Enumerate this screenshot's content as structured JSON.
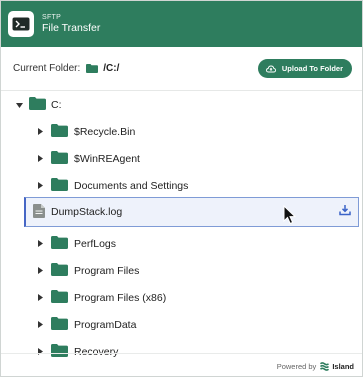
{
  "header": {
    "subtitle": "SFTP",
    "title": "File Transfer",
    "accent_color": "#2e7d5e"
  },
  "folder_bar": {
    "label": "Current Folder:",
    "path": "/C:/",
    "upload_button_label": "Upload To Folder"
  },
  "tree": {
    "root": {
      "name": "C:",
      "expanded": true
    },
    "items": [
      {
        "name": "$Recycle.Bin",
        "type": "folder"
      },
      {
        "name": "$WinREAgent",
        "type": "folder"
      },
      {
        "name": "Documents and Settings",
        "type": "folder"
      },
      {
        "name": "DumpStack.log",
        "type": "file",
        "selected": true
      },
      {
        "name": "PerfLogs",
        "type": "folder"
      },
      {
        "name": "Program Files",
        "type": "folder"
      },
      {
        "name": "Program Files (x86)",
        "type": "folder"
      },
      {
        "name": "ProgramData",
        "type": "folder"
      },
      {
        "name": "Recovery",
        "type": "folder"
      }
    ]
  },
  "footer": {
    "powered_by": "Powered by",
    "brand": "Island"
  },
  "icons": {
    "app": "terminal-icon",
    "folder": "folder-icon",
    "file": "file-icon",
    "upload": "cloud-upload-icon",
    "download": "download-icon",
    "caret_right": "caret-right-icon",
    "caret_down": "caret-down-icon"
  }
}
